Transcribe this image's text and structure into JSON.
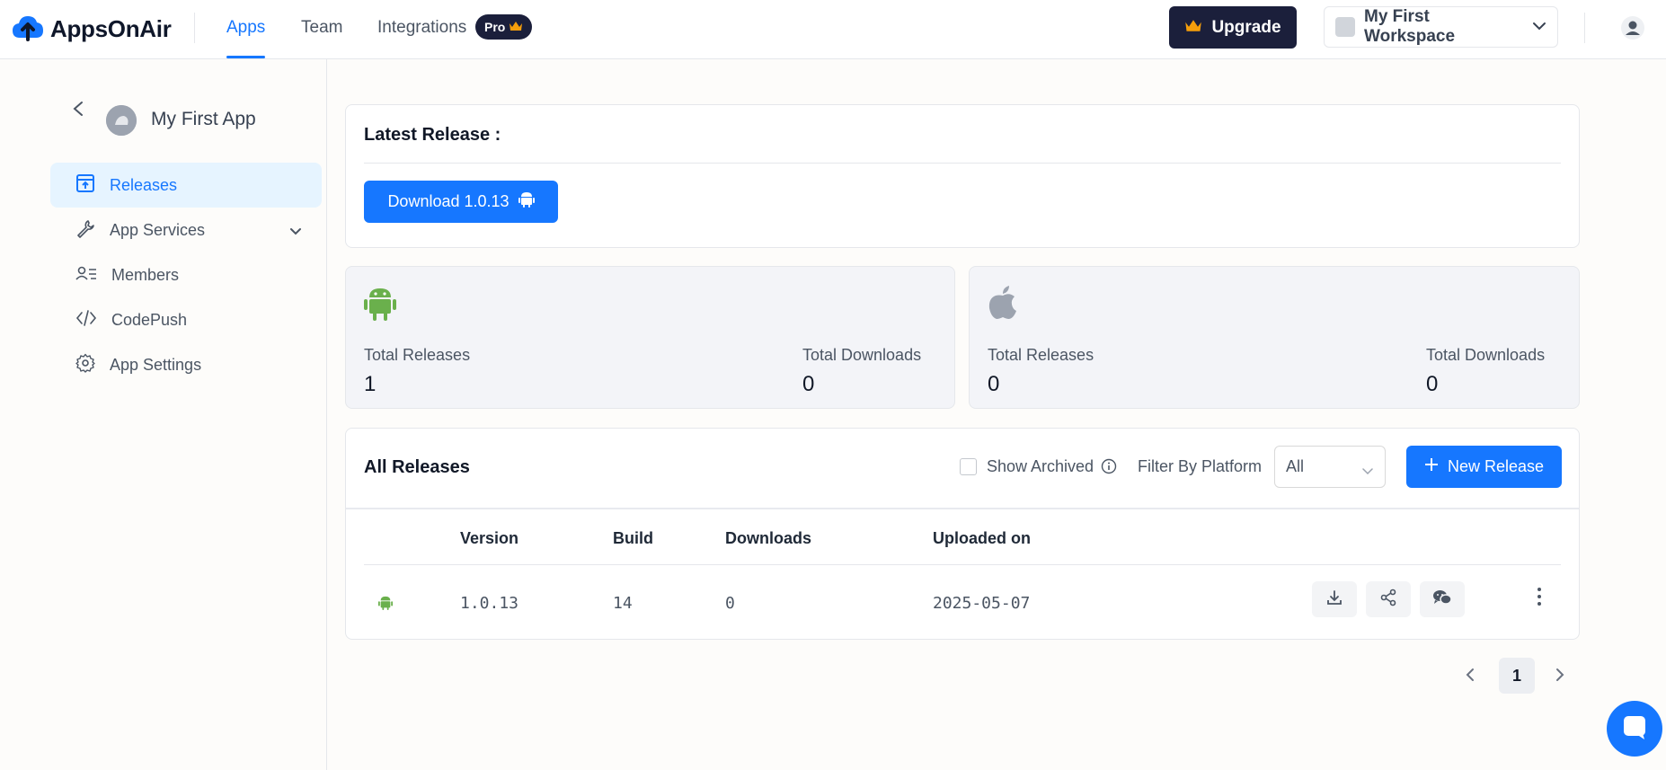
{
  "brand": {
    "name": "AppsOnAir",
    "accent": "#1677ff",
    "dark": "#1b1f3b"
  },
  "nav": {
    "tabs": [
      {
        "label": "Apps",
        "active": true
      },
      {
        "label": "Team",
        "active": false
      },
      {
        "label": "Integrations",
        "active": false
      }
    ],
    "pro_badge": "Pro"
  },
  "header": {
    "upgrade_label": "Upgrade",
    "workspace_name": "My First Workspace"
  },
  "sidebar": {
    "app_name": "My First App",
    "items": [
      {
        "label": "Releases",
        "icon": "upload-box-icon",
        "active": true
      },
      {
        "label": "App Services",
        "icon": "wrench-icon",
        "active": false,
        "expandable": true
      },
      {
        "label": "Members",
        "icon": "members-list-icon",
        "active": false
      },
      {
        "label": "CodePush",
        "icon": "code-icon",
        "active": false
      },
      {
        "label": "App Settings",
        "icon": "gear-icon",
        "active": false
      }
    ]
  },
  "latest_release": {
    "title": "Latest Release :",
    "download_label": "Download 1.0.13",
    "platform_icon": "android-icon"
  },
  "stats": {
    "android": {
      "icon": "android-icon",
      "color": "#6ab04c",
      "total_releases_label": "Total Releases",
      "total_releases": "1",
      "total_downloads_label": "Total Downloads",
      "total_downloads": "0"
    },
    "ios": {
      "icon": "apple-icon",
      "color": "#9ca3af",
      "total_releases_label": "Total Releases",
      "total_releases": "0",
      "total_downloads_label": "Total Downloads",
      "total_downloads": "0"
    }
  },
  "releases": {
    "title": "All Releases",
    "show_archived_label": "Show Archived",
    "show_archived_checked": false,
    "filter_label": "Filter By Platform",
    "filter_value": "All",
    "new_release_label": "New Release",
    "columns": [
      "Version",
      "Build",
      "Downloads",
      "Uploaded on"
    ],
    "rows": [
      {
        "platform": "android-icon",
        "version": "1.0.13",
        "build": "14",
        "downloads": "0",
        "uploaded_on": "2025-05-07"
      }
    ]
  },
  "pagination": {
    "current_page": "1"
  }
}
